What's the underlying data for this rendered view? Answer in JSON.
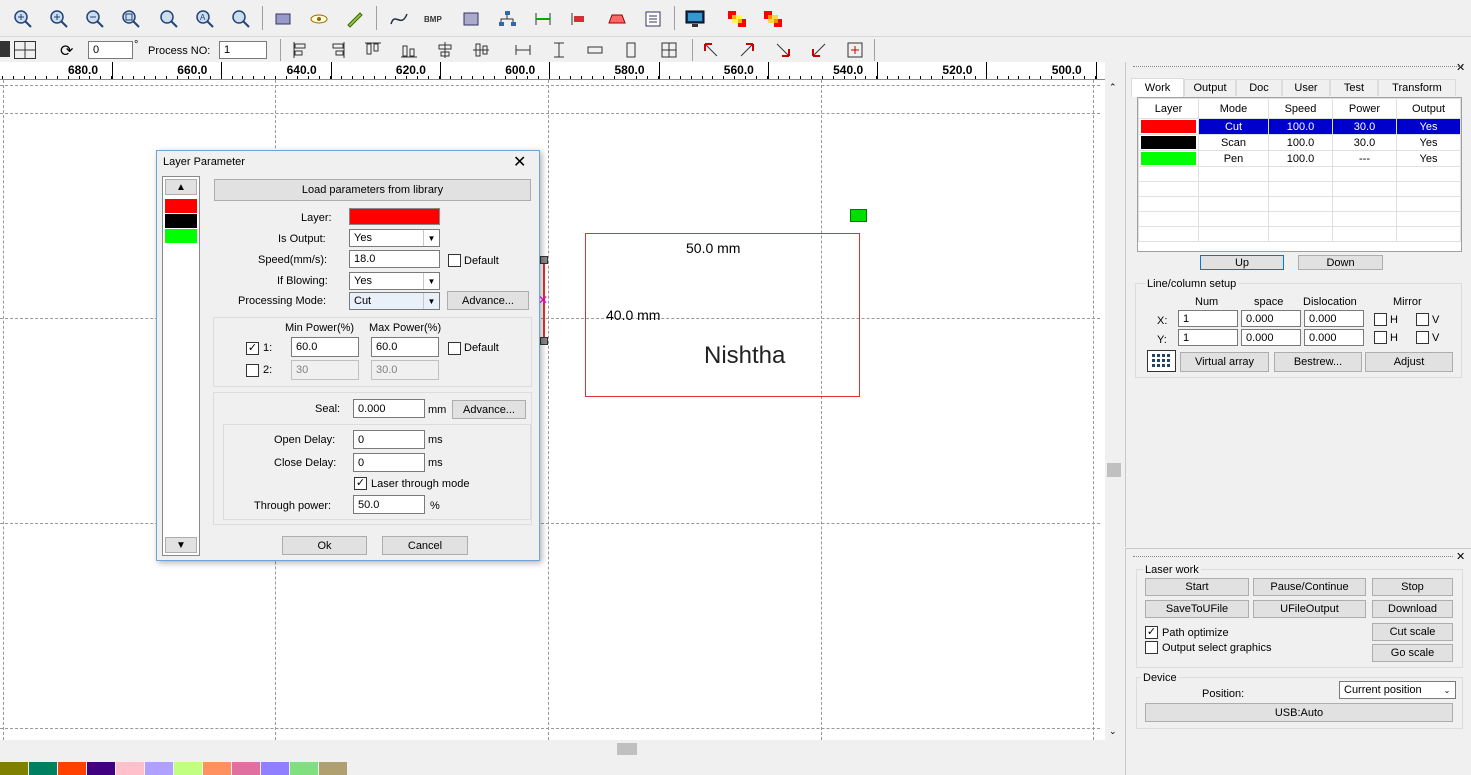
{
  "toolbar2": {
    "angle_value": "0",
    "angle_unit": "°",
    "process_no_label": "Process NO:",
    "process_no_value": "1"
  },
  "ruler": {
    "labels": [
      "680.0",
      "660.0",
      "640.0",
      "620.0",
      "600.0",
      "580.0",
      "560.0",
      "540.0",
      "520.0",
      "500.0"
    ]
  },
  "canvas": {
    "width_dim": "50.0 mm",
    "height_dim": "40.0 mm",
    "text": "Nishtha"
  },
  "dialog": {
    "title": "Layer Parameter",
    "load_btn": "Load parameters from library",
    "layer_label": "Layer:",
    "layer_color": "#ff0000",
    "is_output_label": "Is Output:",
    "is_output_value": "Yes",
    "speed_label": "Speed(mm/s):",
    "speed_value": "18.0",
    "default_label": "Default",
    "if_blowing_label": "If Blowing:",
    "if_blowing_value": "Yes",
    "mode_label": "Processing Mode:",
    "mode_value": "Cut",
    "advance_btn": "Advance...",
    "min_power_label": "Min Power(%)",
    "max_power_label": "Max Power(%)",
    "row1_label": "1:",
    "row1_min": "60.0",
    "row1_max": "60.0",
    "row1_default": "Default",
    "row2_label": "2:",
    "row2_min": "30",
    "row2_max": "30.0",
    "seal_label": "Seal:",
    "seal_value": "0.000",
    "seal_unit": "mm",
    "seal_advance": "Advance...",
    "open_delay_label": "Open Delay:",
    "open_delay_value": "0",
    "open_delay_unit": "ms",
    "close_delay_label": "Close Delay:",
    "close_delay_value": "0",
    "close_delay_unit": "ms",
    "laser_through_label": "Laser through mode",
    "through_power_label": "Through power:",
    "through_power_value": "50.0",
    "through_power_unit": "%",
    "ok_btn": "Ok",
    "cancel_btn": "Cancel",
    "layer_swatches": [
      "#ff0000",
      "#000000",
      "#00ff00"
    ]
  },
  "panel": {
    "tabs": [
      "Work",
      "Output",
      "Doc",
      "User",
      "Test",
      "Transform"
    ],
    "table_headers": [
      "Layer",
      "Mode",
      "Speed",
      "Power",
      "Output"
    ],
    "rows": [
      {
        "color": "#ff0000",
        "mode": "Cut",
        "speed": "100.0",
        "power": "30.0",
        "output": "Yes"
      },
      {
        "color": "#000000",
        "mode": "Scan",
        "speed": "100.0",
        "power": "30.0",
        "output": "Yes"
      },
      {
        "color": "#00ff00",
        "mode": "Pen",
        "speed": "100.0",
        "power": "---",
        "output": "Yes"
      }
    ],
    "up_btn": "Up",
    "down_btn": "Down",
    "line_setup_title": "Line/column setup",
    "col_num": "Num",
    "col_space": "space",
    "col_dislocation": "Dislocation",
    "col_mirror": "Mirror",
    "x_label": "X:",
    "x_num": "1",
    "x_space": "0.000",
    "x_disloc": "0.000",
    "y_label": "Y:",
    "y_num": "1",
    "y_space": "0.000",
    "y_disloc": "0.000",
    "h_label": "H",
    "v_label": "V",
    "virtual_array_btn": "Virtual array",
    "bestrew_btn": "Bestrew...",
    "adjust_btn": "Adjust"
  },
  "laser": {
    "title": "Laser work",
    "start": "Start",
    "pause": "Pause/Continue",
    "stop": "Stop",
    "save_u": "SaveToUFile",
    "ufile_output": "UFileOutput",
    "download": "Download",
    "path_optimize": "Path optimize",
    "output_select": "Output select graphics",
    "cut_scale": "Cut scale",
    "go_scale": "Go scale",
    "device_title": "Device",
    "position_label": "Position:",
    "position_value": "Current position",
    "usb": "USB:Auto"
  },
  "palette": [
    "#808000",
    "#008060",
    "#ff4000",
    "#400080",
    "#ffc0cb",
    "#b0a0ff",
    "#c0ff80",
    "#ff9060",
    "#e070a0",
    "#9080ff",
    "#80e080",
    "#b0a070"
  ]
}
